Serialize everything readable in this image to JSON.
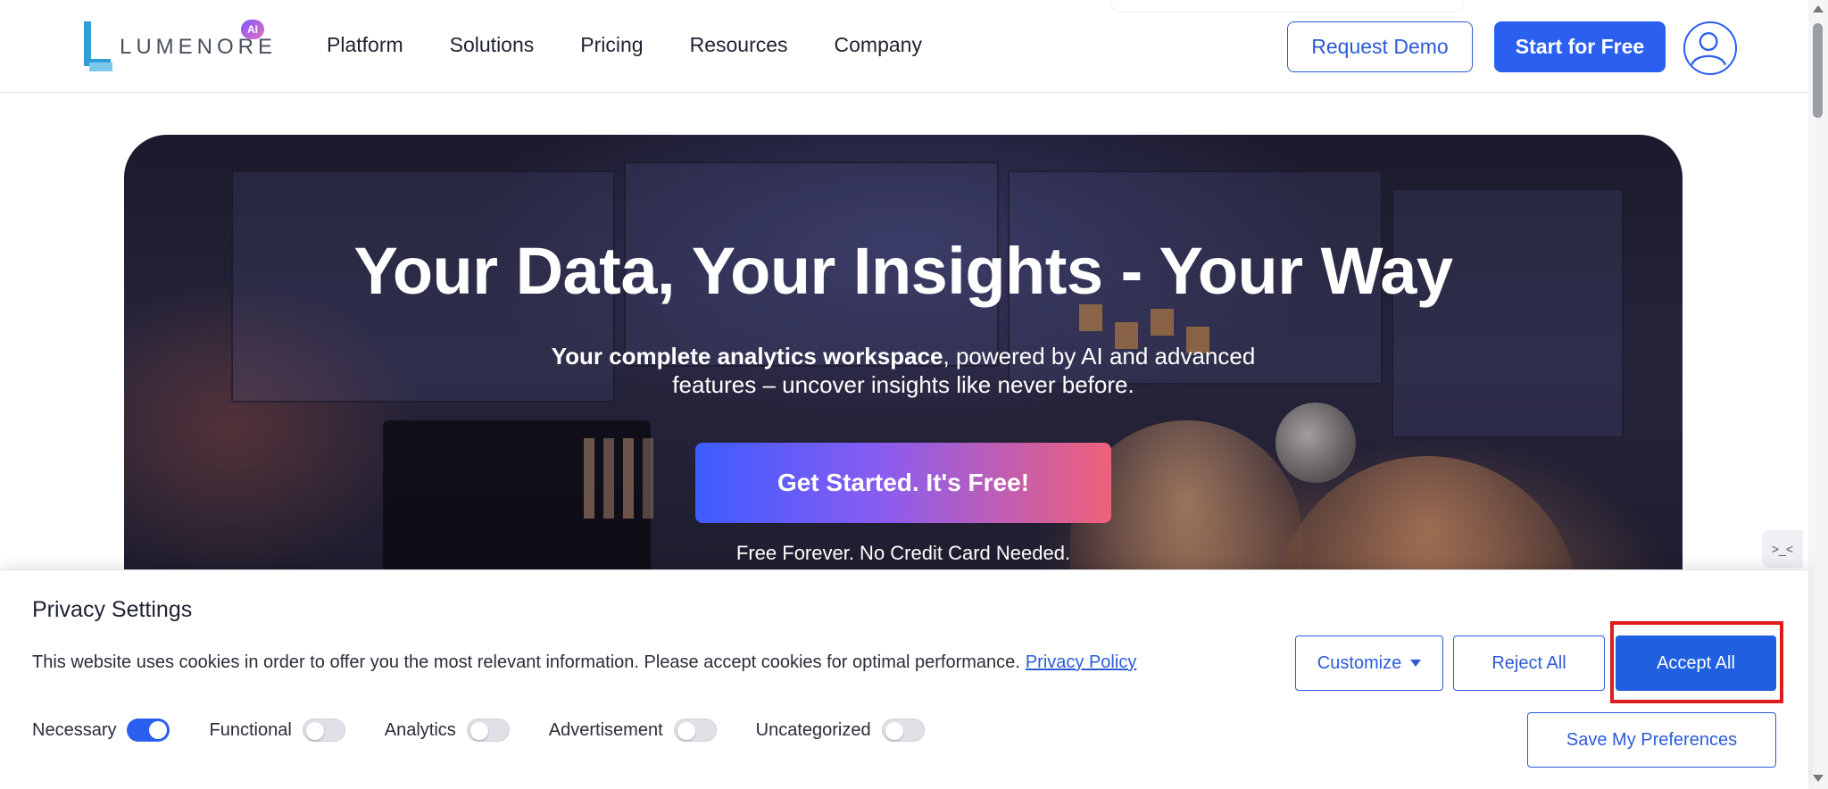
{
  "brand": {
    "name": "LUMENORE",
    "badge": "AI",
    "accent": "#2b5ff0"
  },
  "nav": {
    "items": [
      "Platform",
      "Solutions",
      "Pricing",
      "Resources",
      "Company"
    ]
  },
  "header": {
    "request_demo": "Request Demo",
    "start_free": "Start for Free",
    "avatar_icon": "user-circle-icon"
  },
  "hero": {
    "title": "Your Data, Your Insights - Your Way",
    "subtitle_bold": "Your complete analytics workspace",
    "subtitle_rest": ", powered by AI and advanced",
    "subtitle_line2": "features – uncover insights like never before.",
    "cta": "Get Started. It's Free!",
    "note": "Free Forever. No Credit Card Needed."
  },
  "side_widget": {
    "glyph": ">_<",
    "icon": "code-tab-icon"
  },
  "cookie": {
    "title": "Privacy Settings",
    "text": "This website uses cookies in order to offer you the most relevant information. Please accept cookies for optimal performance.",
    "policy_link": "Privacy Policy",
    "toggles": [
      {
        "label": "Necessary",
        "on": true
      },
      {
        "label": "Functional",
        "on": false
      },
      {
        "label": "Analytics",
        "on": false
      },
      {
        "label": "Advertisement",
        "on": false
      },
      {
        "label": "Uncategorized",
        "on": false
      }
    ],
    "customize": "Customize",
    "reject": "Reject All",
    "accept": "Accept All",
    "save": "Save My Preferences",
    "highlight_color": "#e01b1b"
  }
}
